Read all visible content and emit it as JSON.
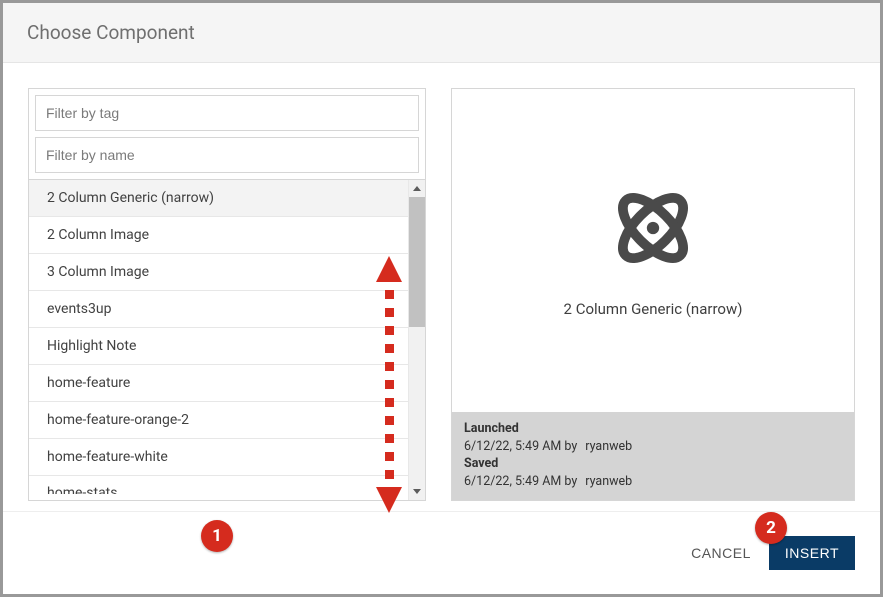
{
  "dialog": {
    "title": "Choose Component"
  },
  "filters": {
    "tag_placeholder": "Filter by tag",
    "name_placeholder": "Filter by name"
  },
  "components": [
    {
      "label": "2 Column Generic (narrow)",
      "selected": true
    },
    {
      "label": "2 Column Image",
      "selected": false
    },
    {
      "label": "3 Column Image",
      "selected": false
    },
    {
      "label": "events3up",
      "selected": false
    },
    {
      "label": "Highlight Note",
      "selected": false
    },
    {
      "label": "home-feature",
      "selected": false
    },
    {
      "label": "home-feature-orange-2",
      "selected": false
    },
    {
      "label": "home-feature-white",
      "selected": false
    },
    {
      "label": "home-stats",
      "selected": false,
      "partial": true
    }
  ],
  "preview": {
    "title": "2 Column Generic (narrow)",
    "launched_label": "Launched",
    "launched_time": "6/12/22, 5:49 AM by",
    "launched_user": "ryanweb",
    "saved_label": "Saved",
    "saved_time": "6/12/22, 5:49 AM by",
    "saved_user": "ryanweb"
  },
  "footer": {
    "cancel": "CANCEL",
    "insert": "INSERT"
  },
  "annotations": {
    "badge1": "1",
    "badge2": "2"
  }
}
